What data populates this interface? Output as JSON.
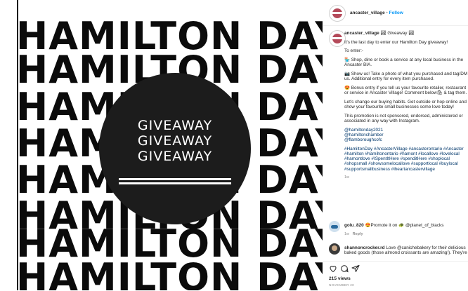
{
  "post_image": {
    "background_words": [
      "HAMILTON DAY",
      "HAMILTON DAY",
      "HAMILTON DAY",
      "HAMILTON DAY",
      "HAMILTON DAY",
      "HAMILTON DAY",
      "HAMILTON DAY",
      "HAMILTON DAY"
    ],
    "center_lines": [
      "GIVEAWAY",
      "GIVEAWAY",
      "GIVEAWAY"
    ]
  },
  "header": {
    "username": "ancaster_village",
    "separator": "•",
    "follow_label": "Follow"
  },
  "caption": {
    "username": "ancaster_village",
    "title_text": "🏞 Giveaway 🏞",
    "paragraphs": [
      "It's the last day to enter our Hamilton Day giveaway!",
      "To enter:-",
      "🏪 Shop, dine or book a service at any local business in the Ancaster BIA.",
      "📷 Show us! Take a photo of what you purchased and tag/DM us. Additional entry for every item purchased.",
      "😍 Bonus entry if you tell us your favourite retailer, restaurant or service in Ancaster Village! Comment below🛍 & tag them.",
      "Let's change our buying habits. Get outside or hop online and show your favourite small businesses some love today!",
      "This promotion is not sponsored, endorsed, administered or associated in any way with Instagram.",
      "@hamiltonday2021\n@hamiltonchamber\n@flamboroughcofc",
      "#HamiltonDay #AncasterVillage #ancasterontario #Ancaster #hamilton #hamiltonontario #hamont #locallove #lovelocal #hamontlove #ISpentItHere #spenditHere #shoplocal #shopsmall #showsomelocallove #supportlocal #buylocal #supportsmallbusiness #iheartancastervillage"
    ],
    "time": "1w"
  },
  "comments": [
    {
      "username": "golu_820",
      "text": "😍Promote it on 🐢 @planet_of_blacks",
      "time": "1w",
      "reply_label": "Reply"
    },
    {
      "username": "shannoncrocker.rd",
      "text": "Love @canichebakery for their delicious baked goods (those almond croissants are amazing!). They're"
    }
  ],
  "actions": {
    "icons": [
      "heart-icon",
      "comment-icon",
      "share-icon"
    ],
    "views": "215 views",
    "date": "NOVEMBER 20"
  },
  "colors": {
    "follow": "#0095f6",
    "text": "#262626",
    "muted": "#8e8e8e",
    "circle": "#1c1c1c"
  }
}
